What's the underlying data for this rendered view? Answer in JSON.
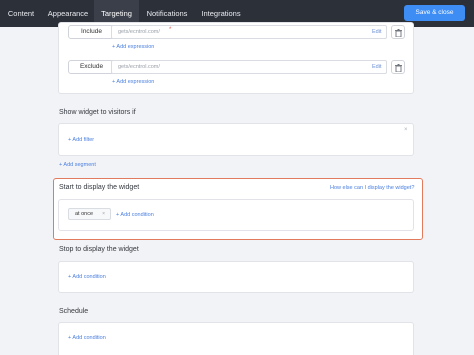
{
  "nav": {
    "tabs": [
      "Content",
      "Appearance",
      "Targeting",
      "Notifications",
      "Integrations"
    ],
    "active_tab": "Targeting",
    "save_label": "Save & close"
  },
  "include": {
    "label": "Include",
    "value": "gets/ecntrol.com/",
    "required_mark": "*",
    "edit_label": "Edit",
    "add_expression": "+ Add expression"
  },
  "exclude": {
    "label": "Exclude",
    "value": "gets/ecntrol.com/",
    "edit_label": "Edit",
    "add_expression": "+ Add expression"
  },
  "show_widget": {
    "title": "Show widget to visitors if",
    "add_filter": "+ Add filter",
    "close": "×",
    "add_segment": "+ Add segment"
  },
  "start_display": {
    "title": "Start to display the widget",
    "help_link": "How else can I display the widget?",
    "pill": "at once",
    "pill_close": "×",
    "add_condition": "+ Add condition"
  },
  "stop_display": {
    "title": "Stop to display the widget",
    "add_condition": "+ Add condition"
  },
  "schedule": {
    "title": "Schedule",
    "add_condition": "+ Add condition"
  },
  "colors": {
    "topbar": "#2c3039",
    "accent": "#3d8df5",
    "highlight": "#e27a5e"
  }
}
